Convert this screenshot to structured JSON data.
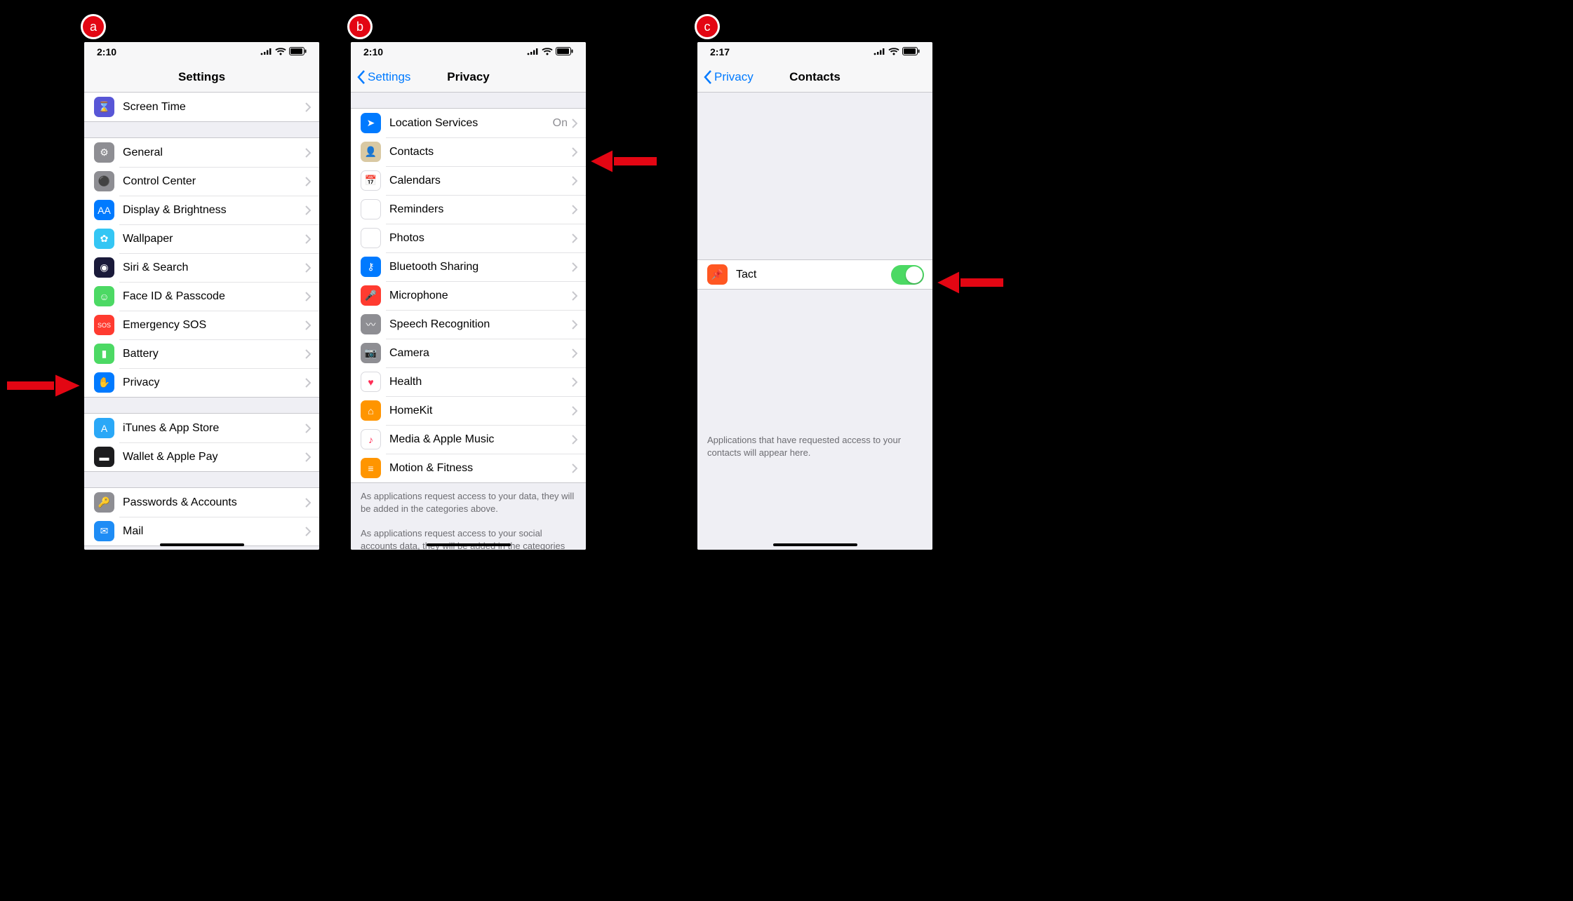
{
  "badges": {
    "a": "a",
    "b": "b",
    "c": "c"
  },
  "screen_a": {
    "time": "2:10",
    "title": "Settings",
    "group_top": [
      {
        "id": "screen-time",
        "label": "Screen Time",
        "icon_bg": "#5856d6",
        "glyph": "⌛"
      }
    ],
    "group_main": [
      {
        "id": "general",
        "label": "General",
        "icon_bg": "#8e8e93",
        "glyph": "⚙"
      },
      {
        "id": "control-center",
        "label": "Control Center",
        "icon_bg": "#8e8e93",
        "glyph": "⚫"
      },
      {
        "id": "display-brightness",
        "label": "Display & Brightness",
        "icon_bg": "#007aff",
        "glyph": "AA"
      },
      {
        "id": "wallpaper",
        "label": "Wallpaper",
        "icon_bg": "#34c6f4",
        "glyph": "✿"
      },
      {
        "id": "siri-search",
        "label": "Siri & Search",
        "icon_bg": "#1a1a3a",
        "glyph": "◉"
      },
      {
        "id": "face-id",
        "label": "Face ID & Passcode",
        "icon_bg": "#4cd964",
        "glyph": "☺"
      },
      {
        "id": "emergency-sos",
        "label": "Emergency SOS",
        "icon_bg": "#ff3b30",
        "glyph": "SOS"
      },
      {
        "id": "battery",
        "label": "Battery",
        "icon_bg": "#4cd964",
        "glyph": "▮"
      },
      {
        "id": "privacy",
        "label": "Privacy",
        "icon_bg": "#007aff",
        "glyph": "✋"
      }
    ],
    "group_store": [
      {
        "id": "itunes",
        "label": "iTunes & App Store",
        "icon_bg": "#2aa8f7",
        "glyph": "A"
      },
      {
        "id": "wallet",
        "label": "Wallet & Apple Pay",
        "icon_bg": "#1c1c1e",
        "glyph": "▬"
      }
    ],
    "group_accounts": [
      {
        "id": "passwords",
        "label": "Passwords & Accounts",
        "icon_bg": "#8e8e93",
        "glyph": "🔑"
      },
      {
        "id": "mail",
        "label": "Mail",
        "icon_bg": "#1e8cf5",
        "glyph": "✉"
      }
    ]
  },
  "screen_b": {
    "time": "2:10",
    "back": "Settings",
    "title": "Privacy",
    "items": [
      {
        "id": "location",
        "label": "Location Services",
        "value": "On",
        "icon_bg": "#007aff",
        "glyph": "➤"
      },
      {
        "id": "contacts",
        "label": "Contacts",
        "icon_bg": "#d9c9a3",
        "glyph": "👤"
      },
      {
        "id": "calendars",
        "label": "Calendars",
        "icon_bg": "#ffffff",
        "glyph": "📅",
        "border": true
      },
      {
        "id": "reminders",
        "label": "Reminders",
        "icon_bg": "#ffffff",
        "glyph": "⋮",
        "border": true
      },
      {
        "id": "photos",
        "label": "Photos",
        "icon_bg": "#ffffff",
        "glyph": "✿",
        "border": true
      },
      {
        "id": "bluetooth",
        "label": "Bluetooth Sharing",
        "icon_bg": "#007aff",
        "glyph": "⚷"
      },
      {
        "id": "microphone",
        "label": "Microphone",
        "icon_bg": "#ff3b30",
        "glyph": "🎤"
      },
      {
        "id": "speech",
        "label": "Speech Recognition",
        "icon_bg": "#8e8e93",
        "glyph": "〰"
      },
      {
        "id": "camera",
        "label": "Camera",
        "icon_bg": "#8e8e93",
        "glyph": "📷"
      },
      {
        "id": "health",
        "label": "Health",
        "icon_bg": "#ffffff",
        "glyph": "♥",
        "border": true,
        "fg": "#ff2d55"
      },
      {
        "id": "homekit",
        "label": "HomeKit",
        "icon_bg": "#ff9500",
        "glyph": "⌂"
      },
      {
        "id": "media",
        "label": "Media & Apple Music",
        "icon_bg": "#ffffff",
        "glyph": "♪",
        "border": true,
        "fg": "#ff2d55"
      },
      {
        "id": "motion",
        "label": "Motion & Fitness",
        "icon_bg": "#ff9500",
        "glyph": "≡"
      }
    ],
    "footer1": "As applications request access to your data, they will be added in the categories above.",
    "footer2": "As applications request access to your social accounts data, they will be added in the categories above."
  },
  "screen_c": {
    "time": "2:17",
    "back": "Privacy",
    "title": "Contacts",
    "app": {
      "id": "tact",
      "label": "Tact",
      "icon_bg": "#ff5722",
      "glyph": "📌",
      "on": true
    },
    "footer": "Applications that have requested access to your contacts will appear here."
  }
}
